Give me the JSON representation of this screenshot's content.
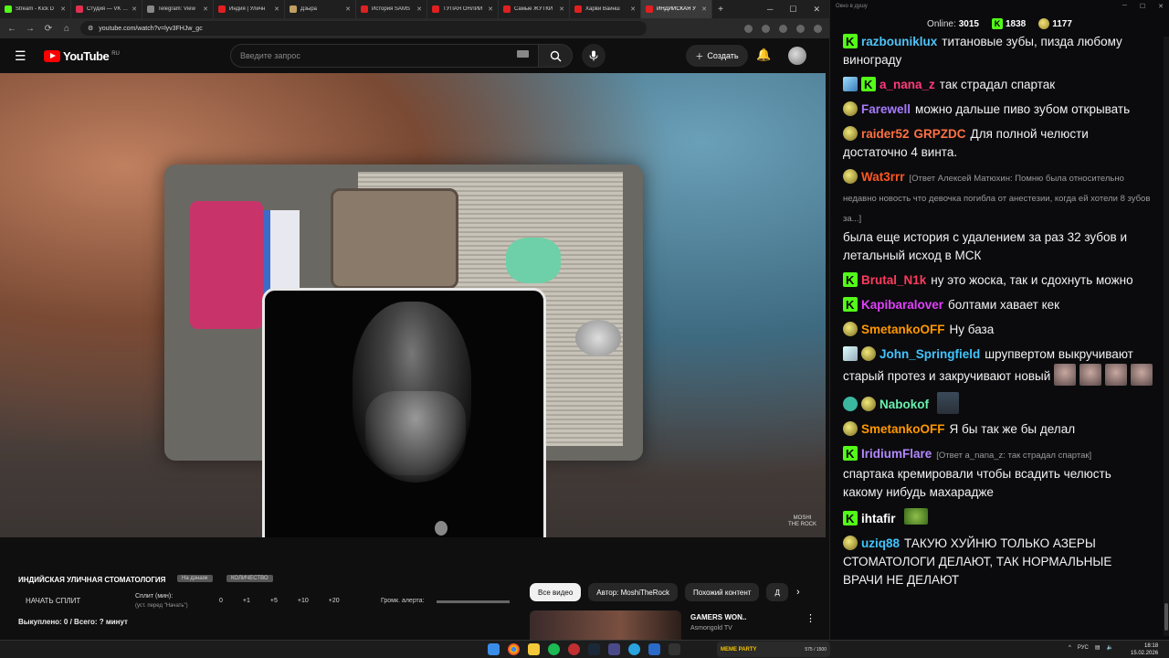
{
  "browser": {
    "tabs": [
      {
        "label": "Stream - Kick D",
        "color": "#53fc18"
      },
      {
        "label": "Студия — VK Ви",
        "color": "#e03050"
      },
      {
        "label": "Telegram: View",
        "color": "#888888"
      },
      {
        "label": "Индия | Уличн",
        "color": "#e02020"
      },
      {
        "label": "Дзыра",
        "color": "#c0a060"
      },
      {
        "label": "История SAMS",
        "color": "#e02020"
      },
      {
        "label": "ТУПАЯ ОНЛИЙ",
        "color": "#e02020"
      },
      {
        "label": "Самые ЖУТКИ",
        "color": "#e02020"
      },
      {
        "label": "Харви Вайнш",
        "color": "#e02020"
      },
      {
        "label": "ИНДИЙСКАЯ У",
        "color": "#e02020"
      }
    ],
    "new_tab": "+",
    "window_controls": [
      "─",
      "☐",
      "✕"
    ],
    "url": "youtube.com/watch?v=lyv3FHJw_gc"
  },
  "youtube": {
    "logo_text": "YouTube",
    "region": "RU",
    "search_placeholder": "Введите запрос",
    "create_label": "Создать",
    "watermark": "MOSHI\nTHE ROCK"
  },
  "below": {
    "title": "ИНДИЙСКАЯ УЛИЧНАЯ СТОМАТОЛОГИЯ",
    "tag1": "На дэнаяк",
    "tag2": "КОЛИЧЕСТВО",
    "split_button": "НАЧАТЬ СПЛИТ",
    "split_label": "Сплит (мин):",
    "split_hint": "(уст. перед \"Начать\")",
    "nums": [
      "0",
      "+1",
      "+5",
      "+10",
      "+20"
    ],
    "alert_label": "Громк. алерта:",
    "bought": "Выкуплено: 0 / Всего: ? минут",
    "chips": [
      "Все видео",
      "Автор: MoshiTheRock",
      "Похожий контент",
      "Д"
    ],
    "rec_title": "GAMERS WON..",
    "rec_channel": "Asmongold TV"
  },
  "chat": {
    "window_title": "Окно в душу",
    "online_label": "Online:",
    "online_count": "3015",
    "kick_count": "1838",
    "sub_count": "1177",
    "messages": [
      {
        "badges": [
          "kick"
        ],
        "user": "razbouniklux",
        "color": "#4fc3f7",
        "text": "титановые зубы, пизда любому винограду"
      },
      {
        "badges": [
          "sword",
          "kick"
        ],
        "user": "a_nana_z",
        "color": "#ff3b7a",
        "text": "так страдал спартак"
      },
      {
        "badges": [
          "sub"
        ],
        "user": "Farewell",
        "color": "#a77bff",
        "text": "можно дальше пиво зубом открывать"
      },
      {
        "badges": [
          "sub"
        ],
        "user": "raider52",
        "color": "#ff7043",
        "user2": "GRPZDC",
        "text": "Для полной челюсти достаточно 4 винта."
      },
      {
        "badges": [
          "sub"
        ],
        "user": "Wat3rrr",
        "color": "#ff5722",
        "reply": "[Ответ Алексей Матюхин: Помню была относительно недавно новость что девочка погибла от анестезии, когда ей хотели 8 зубов за...]",
        "text": "была еще история с удалением за раз 32 зубов и летальный исход в МСК"
      },
      {
        "badges": [
          "kick"
        ],
        "user": "Brutal_N1k",
        "color": "#ff3b5c",
        "text": "ну это жоска, так и сдохнуть можно"
      },
      {
        "badges": [
          "kick"
        ],
        "user": "Kapibaralover",
        "color": "#e040fb",
        "text": "болтами хавает кек"
      },
      {
        "badges": [
          "sub"
        ],
        "user": "SmetankoOFF",
        "color": "#ff9800",
        "text": "Ну база"
      },
      {
        "badges": [
          "blade",
          "sub"
        ],
        "user": "John_Springfield",
        "color": "#40c4ff",
        "text": "шрупвертом выкручивают старый протез и закручивают новый",
        "emotes": 4
      },
      {
        "badges": [
          "check",
          "sub"
        ],
        "user": "Nabokof",
        "color": "#69f0ae",
        "text": "",
        "emotes": 1,
        "emote_type": "guy"
      },
      {
        "badges": [
          "sub"
        ],
        "user": "SmetankoOFF",
        "color": "#ff9800",
        "text": "Я бы так же бы делал"
      },
      {
        "badges": [
          "kick"
        ],
        "user": "IridiumFlare",
        "color": "#b388ff",
        "reply": "[Ответ a_nana_z: так страдал спартак]",
        "text": "спартака кремировали чтобы всадить челюсть какому нибудь махарадже"
      },
      {
        "badges": [
          "kick"
        ],
        "user": "ihtafir",
        "color": "#ffffff",
        "text": "",
        "emotes": 1,
        "emote_type": "frog"
      },
      {
        "badges": [
          "sub"
        ],
        "user": "uziq88",
        "color": "#40c4ff",
        "text": "ТАКУЮ ХУЙНЮ ТОЛЬКО АЗЕРЫ СТОМАТОЛОГИ ДЕЛАЮТ, ТАК НОРМАЛЬНЫЕ ВРАЧИ НЕ ДЕЛАЮТ"
      }
    ]
  },
  "taskbar": {
    "meme_label": "MEME PARTY",
    "meme_count": "575 / 1500",
    "lang": "РУС",
    "time": "18:18",
    "date": "15.02.2026"
  }
}
